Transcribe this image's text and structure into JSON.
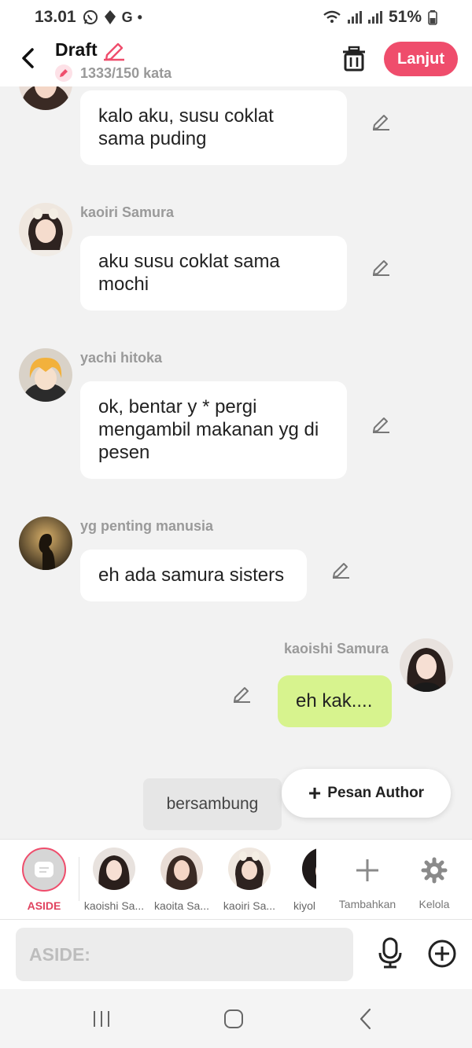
{
  "status_bar": {
    "time": "13.01",
    "notification_icons": [
      "whatsapp-icon",
      "signal-app-icon",
      "google-icon",
      "dot-icon"
    ],
    "google_glyph": "G",
    "dot_glyph": "•",
    "battery": "51%"
  },
  "header": {
    "back_icon": "chevron-left-icon",
    "title": "Draft",
    "word_count": "1333/150 kata",
    "next_button": "Lanjut",
    "accent_color": "#ef4d6c"
  },
  "messages": [
    {
      "sender": "",
      "text_lines": [
        "kalo aku, susu coklat",
        "sama puding"
      ],
      "side": "left"
    },
    {
      "sender": "kaoiri Samura",
      "text_lines": [
        "aku susu coklat sama",
        "mochi"
      ],
      "side": "left"
    },
    {
      "sender": "yachi hitoka",
      "text_lines": [
        "ok, bentar y * pergi",
        "mengambil makanan yg di",
        "pesen"
      ],
      "side": "left"
    },
    {
      "sender": "yg penting manusia",
      "text_lines": [
        "eh ada samura sisters"
      ],
      "side": "left"
    },
    {
      "sender": "kaoishi Samura",
      "text_lines": [
        "eh kak...."
      ],
      "side": "right",
      "bubble_color": "#d7f38e"
    }
  ],
  "continue_label": "bersambung",
  "author_button": {
    "label": "Pesan Author"
  },
  "characters": [
    {
      "label": "ASIDE",
      "selected": true
    },
    {
      "label": "kaoishi Sa..."
    },
    {
      "label": "kaoita Sa..."
    },
    {
      "label": "kaoiri Sa..."
    },
    {
      "label": "kiyol"
    }
  ],
  "tools": [
    {
      "label": "Tambahkan",
      "icon": "plus-icon"
    },
    {
      "label": "Kelola",
      "icon": "gear-icon"
    }
  ],
  "input": {
    "placeholder": "ASIDE:"
  },
  "nav": [
    "recent-apps-icon",
    "home-icon",
    "back-icon"
  ]
}
